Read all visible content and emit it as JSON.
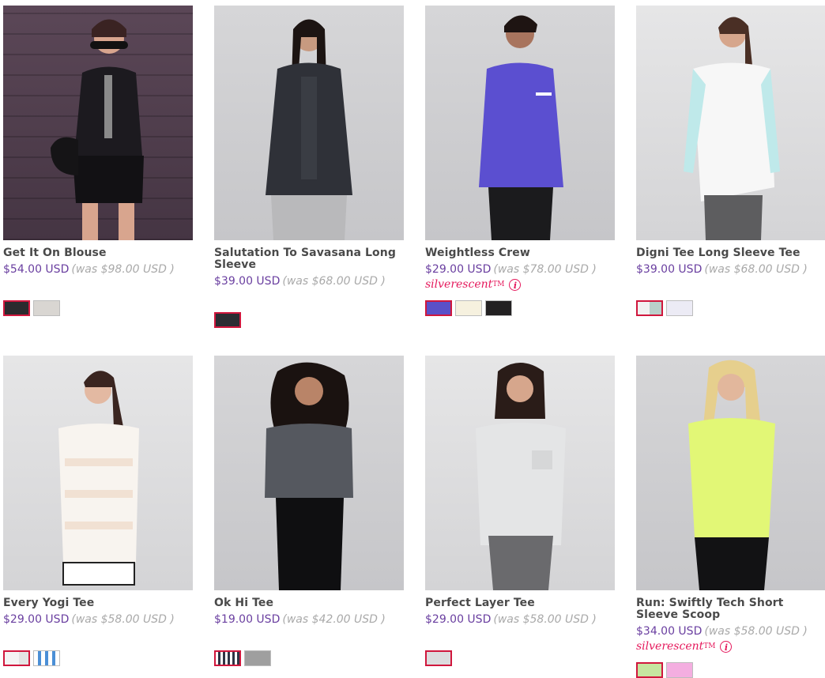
{
  "products": [
    {
      "name": "Get It On Blouse",
      "price": "$54.00 USD",
      "was": "(was $98.00 USD )",
      "badge": "",
      "swatches": [
        "#2b2b2e",
        "#d9d6d2"
      ]
    },
    {
      "name": "Salutation To Savasana Long Sleeve",
      "price": "$39.00 USD",
      "was": "(was $68.00 USD )",
      "badge": "",
      "swatches": [
        "#2b2d33"
      ]
    },
    {
      "name": "Weightless Crew",
      "price": "$29.00 USD",
      "was": "(was $78.00 USD )",
      "badge": "silverescent",
      "swatches": [
        "#5a50c8",
        "#f6f1df",
        "#232122"
      ]
    },
    {
      "name": "Digni Tee Long Sleeve Tee",
      "price": "$39.00 USD",
      "was": "(was $68.00 USD )",
      "badge": "",
      "swatches": [
        "#dcdcdc",
        "#ecebf5"
      ]
    },
    {
      "name": "Every Yogi Tee",
      "price": "$29.00 USD",
      "was": "(was $58.00 USD )",
      "badge": "",
      "swatches": [
        "#efeff0",
        "#4b8fd6"
      ]
    },
    {
      "name": "Ok Hi Tee",
      "price": "$19.00 USD",
      "was": "(was $42.00 USD )",
      "badge": "",
      "swatches": [
        "#2f3445",
        "#9f9f9f"
      ]
    },
    {
      "name": "Perfect Layer Tee",
      "price": "$29.00 USD",
      "was": "(was $58.00 USD )",
      "badge": "",
      "swatches": [
        "#dcdcde"
      ]
    },
    {
      "name": "Run: Swiftly Tech Short Sleeve Scoop",
      "price": "$34.00 USD",
      "was": "(was $58.00 USD )",
      "badge": "silverescent",
      "swatches": [
        "#c6e5a0",
        "#f4aee0"
      ]
    }
  ],
  "badge_tm": "TM",
  "badge_info": "i"
}
